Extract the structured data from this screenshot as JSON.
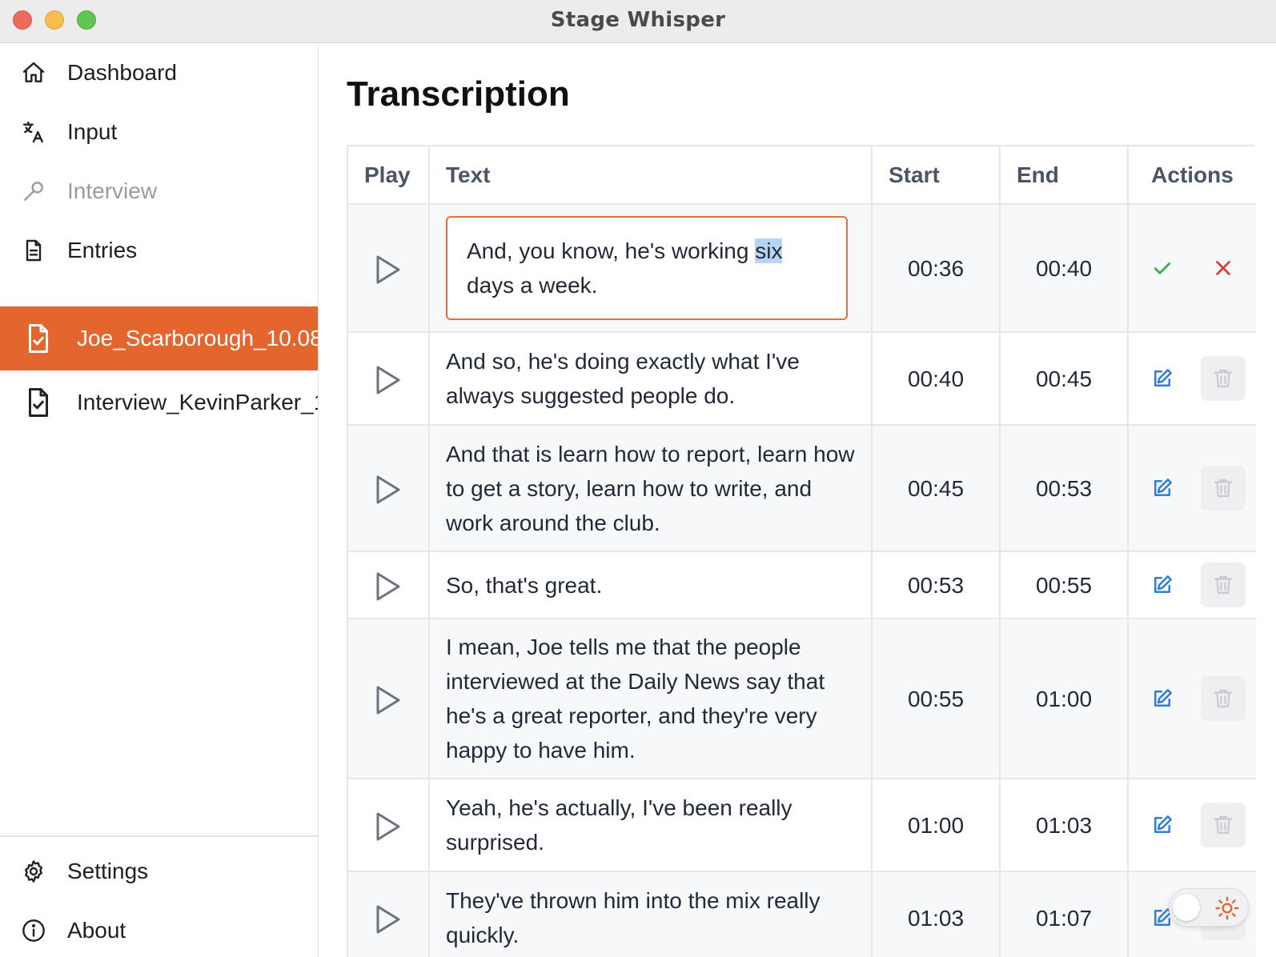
{
  "window": {
    "title": "Stage Whisper"
  },
  "sidebar": {
    "nav": [
      {
        "label": "Dashboard",
        "icon": "home-icon"
      },
      {
        "label": "Input",
        "icon": "translate-icon"
      },
      {
        "label": "Interview",
        "icon": "microphone-icon"
      },
      {
        "label": "Entries",
        "icon": "document-icon"
      }
    ],
    "files": [
      {
        "label": "Joe_Scarborough_10.08",
        "icon": "file-check-icon",
        "active": true
      },
      {
        "label": "Interview_KevinParker_1",
        "icon": "file-check-icon",
        "active": false
      }
    ],
    "footer": [
      {
        "label": "Settings",
        "icon": "gear-icon"
      },
      {
        "label": "About",
        "icon": "info-icon"
      }
    ]
  },
  "main": {
    "title": "Transcription",
    "columns": {
      "play": "Play",
      "text": "Text",
      "start": "Start",
      "end": "End",
      "actions": "Actions"
    },
    "editing": {
      "text_before": "And, you know, he's working ",
      "text_selected": "six",
      "text_after": " days a week.",
      "start": "00:36",
      "end": "00:40"
    },
    "rows": [
      {
        "text": "And so, he's doing exactly what I've always suggested people do.",
        "start": "00:40",
        "end": "00:45"
      },
      {
        "text": "And that is learn how to report, learn how to get a story, learn how to write, and work around the club.",
        "start": "00:45",
        "end": "00:53"
      },
      {
        "text": "So, that's great.",
        "start": "00:53",
        "end": "00:55"
      },
      {
        "text": "I mean, Joe tells me that the people interviewed at the Daily News say that he's a great reporter, and they're very happy to have him.",
        "start": "00:55",
        "end": "01:00"
      },
      {
        "text": "Yeah, he's actually, I've been really surprised.",
        "start": "01:00",
        "end": "01:03"
      },
      {
        "text": "They've thrown him into the mix really quickly.",
        "start": "01:03",
        "end": "01:07"
      }
    ]
  },
  "colors": {
    "accent": "#e5652e",
    "confirm": "#3fae4a",
    "cancel": "#e03c3c",
    "edit": "#2f7fd8"
  }
}
